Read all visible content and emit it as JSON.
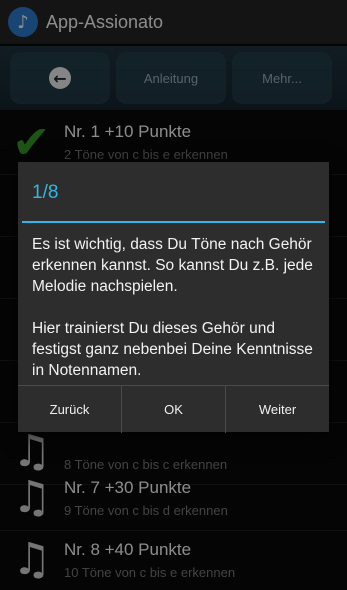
{
  "app": {
    "title": "App-Assionato",
    "icon": "music-note-icon"
  },
  "toolbar": {
    "back_icon": "back-arrow-icon",
    "anleitung": "Anleitung",
    "mehr": "Mehr..."
  },
  "list": {
    "items": [
      {
        "title": "Nr. 1 +10 Punkte",
        "subtitle": "2 Töne von c bis e erkennen",
        "icon": "checkmark-icon"
      },
      {
        "title": "",
        "subtitle": "",
        "icon": "music-note-icon"
      },
      {
        "title": "",
        "subtitle": "",
        "icon": "music-note-icon"
      },
      {
        "title": "",
        "subtitle": "",
        "icon": "music-note-icon"
      },
      {
        "title": "",
        "subtitle": "",
        "icon": "music-note-icon"
      },
      {
        "title": "",
        "subtitle": "8 Töne von c bis c erkennen",
        "icon": "music-note-icon"
      },
      {
        "title": "Nr. 7 +30 Punkte",
        "subtitle": "9 Töne von c bis d erkennen",
        "icon": "music-note-icon"
      },
      {
        "title": "Nr. 8 +40 Punkte",
        "subtitle": "10 Töne von c bis e erkennen",
        "icon": "music-note-icon"
      }
    ]
  },
  "dialog": {
    "title": "1/8",
    "message": "Es ist wichtig, dass Du Töne nach Gehör erkennen kannst. So kannst Du z.B. jede Melodie nachspielen.\n\nHier trainierst Du dieses Gehör und festigst ganz nebenbei Deine Kenntnisse in Notennamen.",
    "buttons": {
      "back": "Zurück",
      "ok": "OK",
      "next": "Weiter"
    }
  },
  "colors": {
    "accent": "#33b5e5",
    "check": "#3a9a2a",
    "app_icon": "#2f7fd6"
  }
}
